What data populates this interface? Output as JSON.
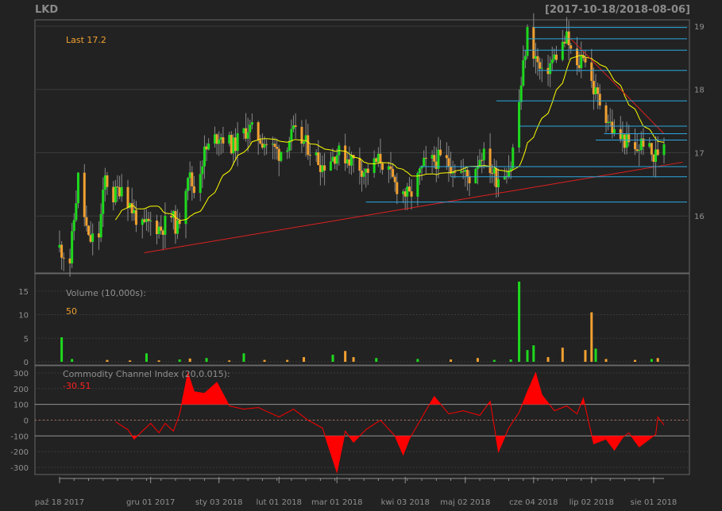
{
  "header": {
    "symbol": "LKD",
    "date_range": "[2017-10-18/2018-08-06]"
  },
  "colors": {
    "background": "#222222",
    "panel_border": "#666666",
    "grid": "#3a3a3a",
    "axis_text": "#909090",
    "up_candle": "#1ed81e",
    "down_candle": "#f0a030",
    "sma_line": "#ffff00",
    "trend_line": "#e02020",
    "support_line": "#2aa8e0",
    "cci_fill": "#ff0000",
    "last_label": "#f0a030",
    "cci_label": "#ff2020"
  },
  "chart_data": [
    {
      "type": "candlestick",
      "panel": "price",
      "last_label": "Last 17.2",
      "ylim": [
        15.1,
        19.1
      ],
      "y_ticks": [
        "16",
        "17",
        "18",
        "19"
      ],
      "overlays": [
        "SMA(20)",
        "trend lines",
        "horizontal support/resistance levels"
      ],
      "price_path": [
        {
          "x": "2017-10-18",
          "y": 15.5
        },
        {
          "x": "2017-10-23",
          "y": 15.3
        },
        {
          "x": "2017-10-27",
          "y": 16.6
        },
        {
          "x": "2017-11-01",
          "y": 15.6
        },
        {
          "x": "2017-11-06",
          "y": 15.7
        },
        {
          "x": "2017-11-09",
          "y": 16.6
        },
        {
          "x": "2017-11-13",
          "y": 16.3
        },
        {
          "x": "2017-11-17",
          "y": 16.5
        },
        {
          "x": "2017-11-22",
          "y": 16.1
        },
        {
          "x": "2017-11-27",
          "y": 15.8
        },
        {
          "x": "2017-12-01",
          "y": 15.9
        },
        {
          "x": "2017-12-06",
          "y": 15.8
        },
        {
          "x": "2017-12-11",
          "y": 16.0
        },
        {
          "x": "2017-12-14",
          "y": 15.8
        },
        {
          "x": "2017-12-19",
          "y": 16.7
        },
        {
          "x": "2017-12-22",
          "y": 16.4
        },
        {
          "x": "2017-12-27",
          "y": 17.0
        },
        {
          "x": "2018-01-03",
          "y": 17.3
        },
        {
          "x": "2018-01-10",
          "y": 17.1
        },
        {
          "x": "2018-01-17",
          "y": 17.4
        },
        {
          "x": "2018-01-24",
          "y": 17.2
        },
        {
          "x": "2018-02-01",
          "y": 17.0
        },
        {
          "x": "2018-02-08",
          "y": 17.3
        },
        {
          "x": "2018-02-15",
          "y": 17.1
        },
        {
          "x": "2018-02-22",
          "y": 16.8
        },
        {
          "x": "2018-03-01",
          "y": 17.0
        },
        {
          "x": "2018-03-08",
          "y": 16.9
        },
        {
          "x": "2018-03-15",
          "y": 16.7
        },
        {
          "x": "2018-03-22",
          "y": 16.9
        },
        {
          "x": "2018-03-29",
          "y": 16.5
        },
        {
          "x": "2018-04-05",
          "y": 16.3
        },
        {
          "x": "2018-04-12",
          "y": 16.8
        },
        {
          "x": "2018-04-19",
          "y": 16.9
        },
        {
          "x": "2018-04-26",
          "y": 16.8
        },
        {
          "x": "2018-05-04",
          "y": 16.6
        },
        {
          "x": "2018-05-10",
          "y": 17.0
        },
        {
          "x": "2018-05-17",
          "y": 16.6
        },
        {
          "x": "2018-05-24",
          "y": 16.8
        },
        {
          "x": "2018-05-28",
          "y": 17.8
        },
        {
          "x": "2018-06-01",
          "y": 18.9
        },
        {
          "x": "2018-06-05",
          "y": 18.5
        },
        {
          "x": "2018-06-08",
          "y": 18.2
        },
        {
          "x": "2018-06-14",
          "y": 18.5
        },
        {
          "x": "2018-06-20",
          "y": 18.8
        },
        {
          "x": "2018-06-25",
          "y": 18.3
        },
        {
          "x": "2018-06-28",
          "y": 18.6
        },
        {
          "x": "2018-07-03",
          "y": 18.0
        },
        {
          "x": "2018-07-09",
          "y": 17.6
        },
        {
          "x": "2018-07-13",
          "y": 17.3
        },
        {
          "x": "2018-07-18",
          "y": 17.2
        },
        {
          "x": "2018-07-23",
          "y": 17.0
        },
        {
          "x": "2018-07-27",
          "y": 17.2
        },
        {
          "x": "2018-08-01",
          "y": 16.9
        },
        {
          "x": "2018-08-06",
          "y": 17.2
        }
      ]
    },
    {
      "type": "bar",
      "panel": "volume",
      "title": "Volume (10,000s):",
      "last_value": "50",
      "ylim": [
        0,
        18
      ],
      "y_ticks": [
        "0",
        "5",
        "10",
        "15"
      ],
      "bars": [
        {
          "x": "2017-10-19",
          "y": 5.2,
          "dir": "up"
        },
        {
          "x": "2017-10-24",
          "y": 0.6,
          "dir": "up"
        },
        {
          "x": "2017-11-10",
          "y": 0.4,
          "dir": "down"
        },
        {
          "x": "2017-11-21",
          "y": 0.3,
          "dir": "down"
        },
        {
          "x": "2017-11-29",
          "y": 1.8,
          "dir": "up"
        },
        {
          "x": "2017-12-05",
          "y": 0.3,
          "dir": "down"
        },
        {
          "x": "2017-12-15",
          "y": 0.5,
          "dir": "up"
        },
        {
          "x": "2017-12-20",
          "y": 0.7,
          "dir": "down"
        },
        {
          "x": "2017-12-28",
          "y": 0.8,
          "dir": "up"
        },
        {
          "x": "2018-01-08",
          "y": 0.3,
          "dir": "down"
        },
        {
          "x": "2018-01-15",
          "y": 1.8,
          "dir": "up"
        },
        {
          "x": "2018-01-25",
          "y": 0.4,
          "dir": "down"
        },
        {
          "x": "2018-02-05",
          "y": 0.4,
          "dir": "down"
        },
        {
          "x": "2018-02-13",
          "y": 1.0,
          "dir": "down"
        },
        {
          "x": "2018-02-27",
          "y": 1.5,
          "dir": "up"
        },
        {
          "x": "2018-03-05",
          "y": 2.3,
          "dir": "down"
        },
        {
          "x": "2018-03-09",
          "y": 1.0,
          "dir": "down"
        },
        {
          "x": "2018-03-20",
          "y": 0.8,
          "dir": "up"
        },
        {
          "x": "2018-04-09",
          "y": 0.6,
          "dir": "up"
        },
        {
          "x": "2018-04-25",
          "y": 0.5,
          "dir": "down"
        },
        {
          "x": "2018-05-08",
          "y": 0.8,
          "dir": "down"
        },
        {
          "x": "2018-05-16",
          "y": 0.4,
          "dir": "up"
        },
        {
          "x": "2018-05-24",
          "y": 0.5,
          "dir": "up"
        },
        {
          "x": "2018-05-28",
          "y": 17.0,
          "dir": "up"
        },
        {
          "x": "2018-06-01",
          "y": 2.5,
          "dir": "up"
        },
        {
          "x": "2018-06-04",
          "y": 3.5,
          "dir": "up"
        },
        {
          "x": "2018-06-11",
          "y": 1.0,
          "dir": "down"
        },
        {
          "x": "2018-06-18",
          "y": 3.0,
          "dir": "down"
        },
        {
          "x": "2018-06-29",
          "y": 2.5,
          "dir": "down"
        },
        {
          "x": "2018-07-02",
          "y": 10.5,
          "dir": "down"
        },
        {
          "x": "2018-07-04",
          "y": 2.8,
          "dir": "up"
        },
        {
          "x": "2018-07-09",
          "y": 0.6,
          "dir": "down"
        },
        {
          "x": "2018-07-23",
          "y": 0.4,
          "dir": "down"
        },
        {
          "x": "2018-07-31",
          "y": 0.6,
          "dir": "up"
        },
        {
          "x": "2018-08-03",
          "y": 0.8,
          "dir": "down"
        }
      ]
    },
    {
      "type": "area",
      "panel": "indicator",
      "title": "Commodity Channel Index (20,0.015):",
      "last_value": "-30.51",
      "ylim": [
        -330,
        330
      ],
      "y_ticks": [
        "-300",
        "-200",
        "-100",
        "0",
        "100",
        "200",
        "300"
      ],
      "bands": [
        -100,
        0,
        100
      ],
      "series": [
        {
          "x": "2017-11-14",
          "y": -10
        },
        {
          "x": "2017-11-20",
          "y": -60
        },
        {
          "x": "2017-11-23",
          "y": -120
        },
        {
          "x": "2017-11-27",
          "y": -70
        },
        {
          "x": "2017-12-01",
          "y": -20
        },
        {
          "x": "2017-12-05",
          "y": -80
        },
        {
          "x": "2017-12-08",
          "y": -20
        },
        {
          "x": "2017-12-12",
          "y": -70
        },
        {
          "x": "2017-12-15",
          "y": 40
        },
        {
          "x": "2017-12-19",
          "y": 300
        },
        {
          "x": "2017-12-22",
          "y": 180
        },
        {
          "x": "2017-12-27",
          "y": 170
        },
        {
          "x": "2018-01-02",
          "y": 240
        },
        {
          "x": "2018-01-08",
          "y": 90
        },
        {
          "x": "2018-01-15",
          "y": 70
        },
        {
          "x": "2018-01-22",
          "y": 80
        },
        {
          "x": "2018-02-01",
          "y": 20
        },
        {
          "x": "2018-02-08",
          "y": 70
        },
        {
          "x": "2018-02-15",
          "y": 0
        },
        {
          "x": "2018-02-22",
          "y": -50
        },
        {
          "x": "2018-03-01",
          "y": -330
        },
        {
          "x": "2018-03-05",
          "y": -70
        },
        {
          "x": "2018-03-09",
          "y": -140
        },
        {
          "x": "2018-03-15",
          "y": -60
        },
        {
          "x": "2018-03-22",
          "y": 0
        },
        {
          "x": "2018-03-29",
          "y": -100
        },
        {
          "x": "2018-04-02",
          "y": -220
        },
        {
          "x": "2018-04-05",
          "y": -120
        },
        {
          "x": "2018-04-12",
          "y": 40
        },
        {
          "x": "2018-04-17",
          "y": 150
        },
        {
          "x": "2018-04-24",
          "y": 40
        },
        {
          "x": "2018-05-01",
          "y": 60
        },
        {
          "x": "2018-05-09",
          "y": 30
        },
        {
          "x": "2018-05-14",
          "y": 120
        },
        {
          "x": "2018-05-18",
          "y": -200
        },
        {
          "x": "2018-05-23",
          "y": -50
        },
        {
          "x": "2018-05-28",
          "y": 50
        },
        {
          "x": "2018-06-01",
          "y": 180
        },
        {
          "x": "2018-06-05",
          "y": 300
        },
        {
          "x": "2018-06-08",
          "y": 160
        },
        {
          "x": "2018-06-14",
          "y": 60
        },
        {
          "x": "2018-06-20",
          "y": 90
        },
        {
          "x": "2018-06-25",
          "y": 40
        },
        {
          "x": "2018-06-28",
          "y": 140
        },
        {
          "x": "2018-07-03",
          "y": -150
        },
        {
          "x": "2018-07-09",
          "y": -120
        },
        {
          "x": "2018-07-13",
          "y": -190
        },
        {
          "x": "2018-07-17",
          "y": -110
        },
        {
          "x": "2018-07-20",
          "y": -80
        },
        {
          "x": "2018-07-25",
          "y": -170
        },
        {
          "x": "2018-07-30",
          "y": -120
        },
        {
          "x": "2018-08-02",
          "y": -90
        },
        {
          "x": "2018-08-03",
          "y": 20
        },
        {
          "x": "2018-08-06",
          "y": -30.51
        }
      ]
    }
  ],
  "x_axis": {
    "start": "2017-10-18",
    "end": "2018-08-06",
    "ticks": [
      {
        "date": "2017-10-18",
        "label": "paź 18 2017"
      },
      {
        "date": "2017-12-01",
        "label": "gru 01 2017"
      },
      {
        "date": "2018-01-03",
        "label": "sty 03 2018"
      },
      {
        "date": "2018-02-01",
        "label": "lut 01 2018"
      },
      {
        "date": "2018-03-01",
        "label": "mar 01 2018"
      },
      {
        "date": "2018-04-03",
        "label": "kwi 03 2018"
      },
      {
        "date": "2018-05-02",
        "label": "maj 02 2018"
      },
      {
        "date": "2018-06-04",
        "label": "cze 04 2018"
      },
      {
        "date": "2018-07-02",
        "label": "lip 02 2018"
      },
      {
        "date": "2018-08-01",
        "label": "sie 01 2018"
      }
    ]
  }
}
